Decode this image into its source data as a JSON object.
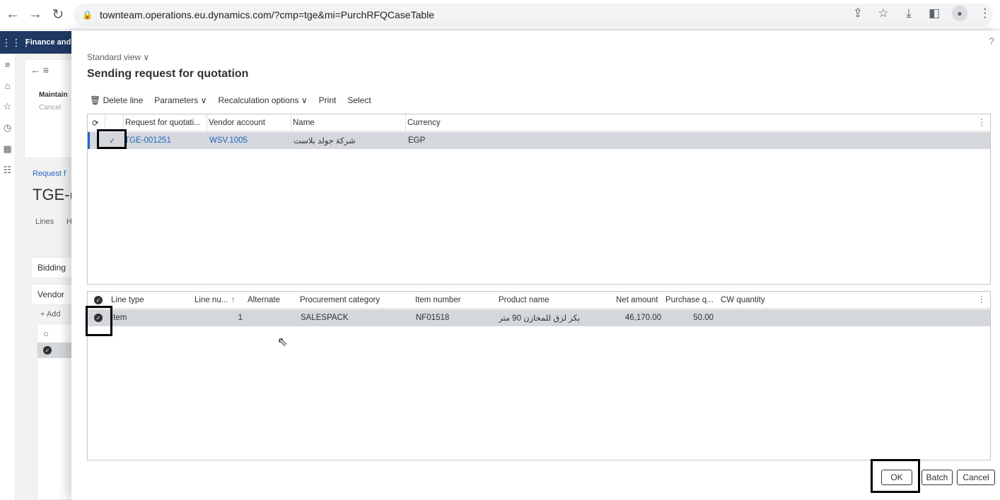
{
  "browser": {
    "url": "townteam.operations.eu.dynamics.com/?cmp=tge&mi=PurchRFQCaseTable",
    "back_icon": "←",
    "forward_icon": "→",
    "reload_icon": "↻"
  },
  "background_app": {
    "app_name": "Finance and",
    "toolbar_label": "Maintain",
    "toolbar_sub": "Cancel",
    "breadcrumb": "Request f",
    "record_title": "TGE-(",
    "tab_lines": "Lines",
    "tab_h": "H",
    "section_bidding": "Bidding",
    "section_vendor": "Vendor",
    "add_label": "+ Add"
  },
  "dialog": {
    "view_selector": "Standard view",
    "title": "Sending request for quotation",
    "help": "?",
    "toolbar": {
      "delete_line": "Delete line",
      "parameters": "Parameters",
      "recalculation": "Recalculation options",
      "print": "Print",
      "select": "Select"
    },
    "rfq_grid": {
      "headers": [
        "Request for quotati...",
        "Vendor account",
        "Name",
        "Currency"
      ],
      "rows": [
        {
          "rfq": "TGE-001251",
          "vendor": "WSV.1005",
          "name": "شركة جولد بلاست",
          "currency": "EGP"
        }
      ]
    },
    "lines_grid": {
      "headers": [
        "Line type",
        "Line nu...",
        "Alternate",
        "Procurement category",
        "Item number",
        "Product name",
        "Net amount",
        "Purchase q...",
        "CW quantity"
      ],
      "rows": [
        {
          "line_type": "Item",
          "line_number": "1",
          "alternate": "",
          "category": "SALESPACK",
          "item_number": "NF01518",
          "product_name": "بكر لزق للمخازن 90 متر",
          "net_amount": "46,170.00",
          "purchase_qty": "50.00",
          "cw_qty": ""
        }
      ]
    },
    "buttons": {
      "ok": "OK",
      "batch": "Batch",
      "cancel": "Cancel"
    }
  }
}
